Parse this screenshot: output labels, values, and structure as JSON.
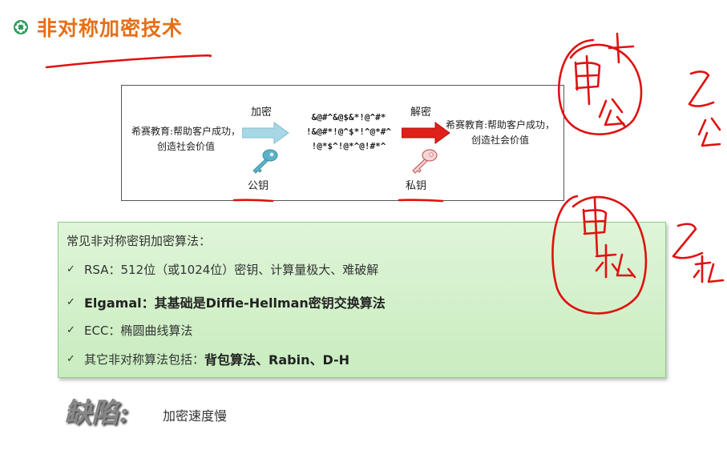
{
  "title": "非对称加密技术",
  "diagram": {
    "plaintext_left": "希赛教育:帮助客户成功，创造社会价值",
    "plaintext_right": "希赛教育:帮助客户成功，创造社会价值",
    "encrypt_label": "加密",
    "decrypt_label": "解密",
    "ciphertext_line1": "&@#^&@$&*!@^#*",
    "ciphertext_line2": "!&@#*!@^$*!^@*#^",
    "ciphertext_line3": "!@*$^!@*^@!#*^",
    "public_key_label": "公钥",
    "private_key_label": "私钥",
    "colors": {
      "encrypt_arrow": "#a8d8e6",
      "decrypt_arrow": "#e0201a",
      "public_key": "#5bb3c9",
      "private_key": "#d87070"
    }
  },
  "algorithms": {
    "heading": "常见非对称密钥加密算法：",
    "items": [
      {
        "text": "RSA：512位（或1024位）密钥、计算量极大、难破解"
      },
      {
        "text": "Elgamal：其基础是Diffie-Hellman密钥交换算法"
      },
      {
        "text": "ECC：椭圆曲线算法"
      },
      {
        "prefix": "其它非对称算法包括：",
        "bold": "背包算法、Rabin、D-H"
      }
    ]
  },
  "defect": {
    "label": "缺陷:",
    "text": "加密速度慢"
  },
  "annotations": {
    "ink_color": "#e01010",
    "upper_circle": "甲公",
    "upper_right": "乙公",
    "lower_circle": "甲私",
    "lower_right": "乙私"
  }
}
